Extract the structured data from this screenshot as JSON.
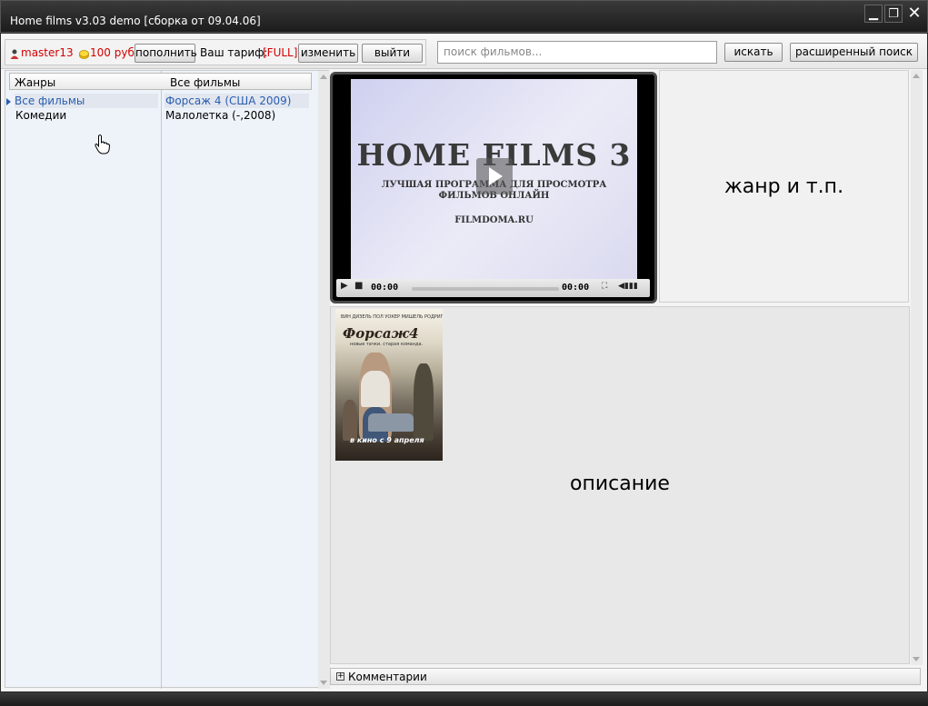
{
  "window": {
    "title": "Home films v3.03 demo [сборка от 09.04.06]",
    "minimize_glyph": "▁",
    "restore_glyph": "❐",
    "close_glyph": "✕"
  },
  "toolbar": {
    "username": "master13",
    "balance": "100 руб",
    "topup_label": "пополнить",
    "tariff_label": "Ваш тариф:",
    "tariff_value": "[FULL]",
    "change_label": "изменить",
    "logout_label": "выйти",
    "search_placeholder": "поиск фильмов...",
    "search_label": "искать",
    "advanced_search_label": "расширенный поиск"
  },
  "genres": {
    "header": "Жанры",
    "items": [
      {
        "label": "Все фильмы",
        "selected": true
      },
      {
        "label": "Комедии",
        "selected": false
      }
    ]
  },
  "films": {
    "header": "Все фильмы",
    "items": [
      {
        "label": "Форсаж 4 (США 2009)",
        "selected": true
      },
      {
        "label": "Малолетка (-,2008)",
        "selected": false
      }
    ]
  },
  "player": {
    "title": "HOME FILMS 3",
    "subtitle_line1": "ЛУЧШАЯ ПРОГРАММА ДЛЯ ПРОСМОТРА",
    "subtitle_line2": "ФИЛЬМОВ ОНЛАЙН",
    "site": "FILMDOMA.RU",
    "time_elapsed": "00:00",
    "time_total": "00:00",
    "progress": 0
  },
  "genre_info": "жанр и т.п.",
  "description": "описание",
  "poster": {
    "names": "ВИН ДИЗЕЛЬ   ПОЛ УОКЕР   МИШЕЛЬ РОДРИГЕС   ДЖОРДАНА БРЮСТЕР",
    "title": "Форсаж4",
    "tagline": "новые тачки. старая команда.",
    "release": "в кино с 9 апреля"
  },
  "comments_label": "Комментарии",
  "colors": {
    "accent": "#2a5db0",
    "warning": "#d40000",
    "chrome": "#1c1c1c"
  }
}
